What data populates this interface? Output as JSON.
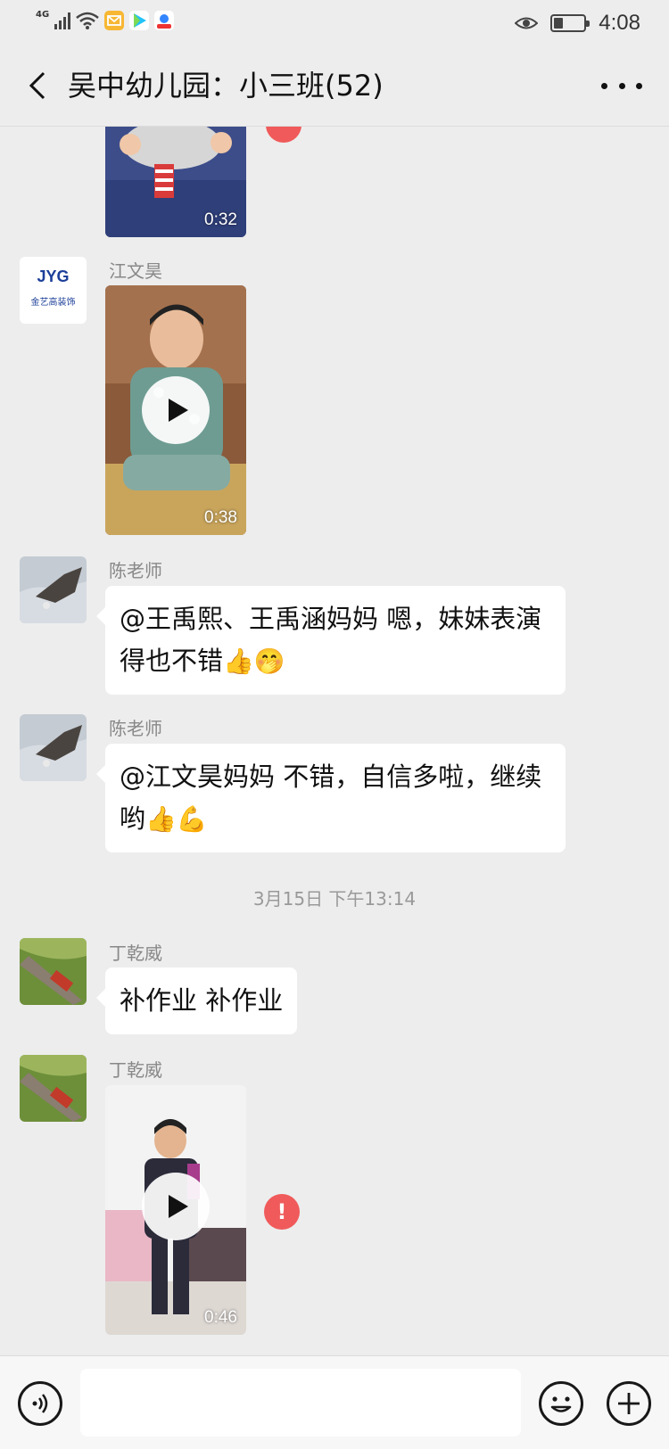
{
  "status_bar": {
    "network": "4G",
    "time": "4:08",
    "battery_level": 0.3,
    "icons": [
      "signal-icon",
      "wifi-icon",
      "mail-app-icon",
      "video-app-icon",
      "baidu-app-icon",
      "eye-icon",
      "battery-icon"
    ]
  },
  "header": {
    "title": "吴中幼儿园：小三班(52)",
    "back_icon": "chevron-left-icon",
    "more_icon": "more-dots-icon"
  },
  "messages": [
    {
      "type": "video",
      "sender": "",
      "duration": "0:32",
      "partial": true
    },
    {
      "type": "video",
      "sender": "江文昊",
      "avatar_text": "JYG",
      "avatar_subtext": "金艺高装饰",
      "duration": "0:38"
    },
    {
      "type": "text",
      "sender": "陈老师",
      "text": "@王禹熙、王禹涵妈妈  嗯，妹妹表演得也不错",
      "emojis": "👍🤭"
    },
    {
      "type": "text",
      "sender": "陈老师",
      "text": "@江文昊妈妈  不错，自信多啦，继续哟",
      "emojis": "👍💪"
    },
    {
      "type": "timestamp",
      "text": "3月15日 下午13:14"
    },
    {
      "type": "text",
      "sender": "丁乾威",
      "text": "补作业 补作业"
    },
    {
      "type": "video",
      "sender": "丁乾威",
      "duration": "0:46",
      "send_failed": true,
      "error_mark": "!"
    }
  ],
  "input_bar": {
    "placeholder": "",
    "value": "",
    "voice_icon": "voice-icon",
    "emoji_icon": "emoji-icon",
    "plus_icon": "plus-icon"
  },
  "colors": {
    "background": "#ededed",
    "bubble": "#ffffff",
    "error": "#f05a5a",
    "timestamp": "#999999"
  }
}
